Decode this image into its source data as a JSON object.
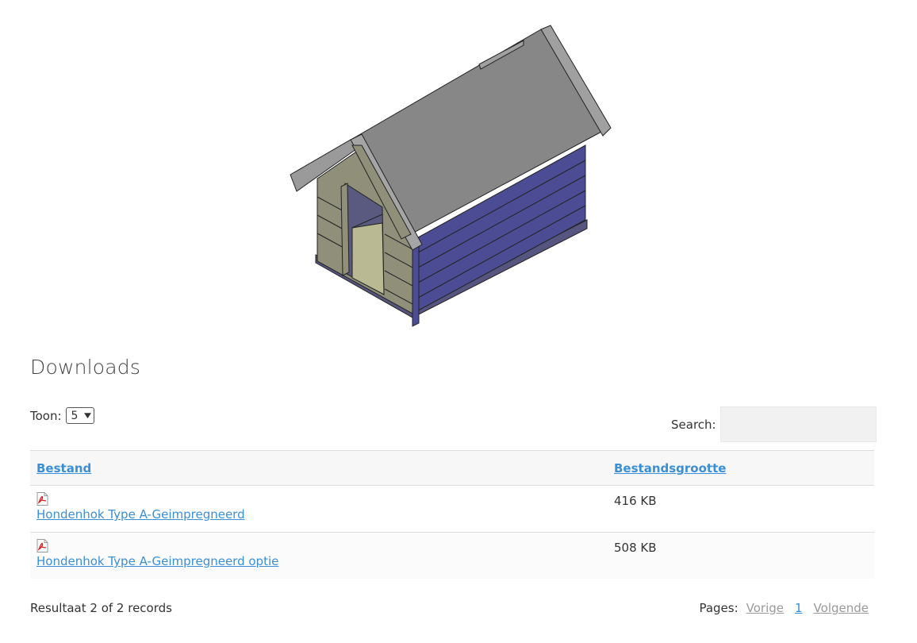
{
  "hero": {
    "image_name": "dog-kennel-illustration",
    "colors": {
      "roof": "#878787",
      "side": "#4c4c94",
      "front": "#8f8f7a",
      "door": "#b9b993",
      "outline": "#222222"
    }
  },
  "downloads": {
    "title": "Downloads",
    "toon_label": "Toon:",
    "toon_value": "5",
    "search_label": "Search:",
    "search_value": "",
    "columns": [
      "Bestand",
      "Bestandsgrootte"
    ],
    "rows": [
      {
        "icon": "pdf-icon",
        "name": "Hondenhok Type A-Geimpregneerd",
        "size": "416 KB"
      },
      {
        "icon": "pdf-icon",
        "name": "Hondenhok Type A-Geimpregneerd optie",
        "size": "508 KB"
      }
    ],
    "result_text": "Resultaat 2 of 2 records",
    "pages_label": "Pages:",
    "prev_label": "Vorige",
    "current_page": "1",
    "next_label": "Volgende"
  },
  "colors": {
    "link": "#3a8fd6",
    "muted_link": "#9a9a9a"
  }
}
